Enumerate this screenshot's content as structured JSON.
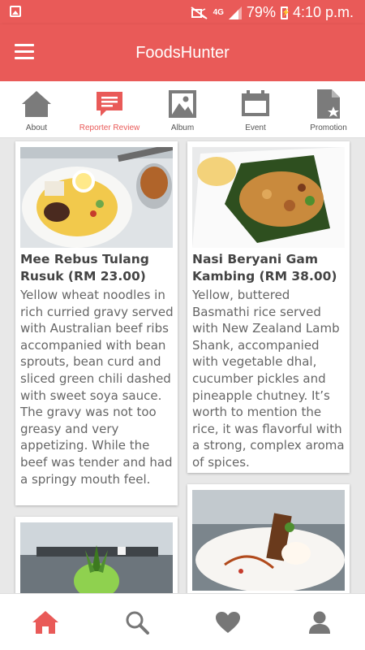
{
  "status_bar": {
    "network": "4G",
    "battery": "79%",
    "time": "4:10 p.m."
  },
  "app": {
    "title": "FoodsHunter"
  },
  "tabs": [
    {
      "label": "About",
      "icon": "home-icon",
      "active": false
    },
    {
      "label": "Reporter Review",
      "icon": "review-icon",
      "active": true
    },
    {
      "label": "Album",
      "icon": "image-icon",
      "active": false
    },
    {
      "label": "Event",
      "icon": "calendar-icon",
      "active": false
    },
    {
      "label": "Promotion",
      "icon": "document-star-icon",
      "active": false
    }
  ],
  "reviews": [
    {
      "title": "Mee Rebus Tulang Rusuk (RM 23.00)",
      "description": "Yellow wheat noodles in rich curried gravy served with Australian beef ribs accompanied with bean sprouts, bean curd and sliced green chili dashed with sweet soya sauce. The gravy was not too greasy and very appetizing. While the beef was tender and had a springy mouth feel."
    },
    {
      "title": "Nasi Beryani Gam Kambing (RM 38.00)",
      "description": "Yellow, buttered Basmathi rice served with New Zealand Lamb Shank, accompanied with vegetable dhal, cucumber pickles and pineapple chutney. It’s worth to mention the rice, it was flavorful with a strong, complex aroma of spices."
    }
  ],
  "bottom_nav": [
    "home-icon",
    "search-icon",
    "heart-icon",
    "profile-icon"
  ],
  "colors": {
    "primary": "#e95a58",
    "active_nav": "#e95a58",
    "inactive_icon": "#777777"
  }
}
